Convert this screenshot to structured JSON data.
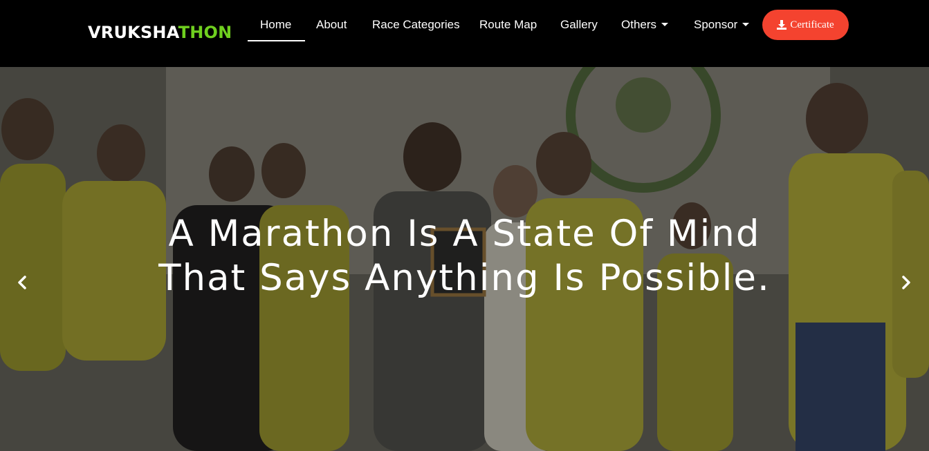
{
  "brand": {
    "part1": "VRUKSHA",
    "part2": "THON"
  },
  "nav": {
    "home": "Home",
    "about": "About",
    "race_categories": "Race Categories",
    "route_map": "Route Map",
    "gallery": "Gallery",
    "others": "Others",
    "sponsor": "Sponsor"
  },
  "certificate": {
    "label": "Certificate",
    "icon": "download-icon"
  },
  "hero": {
    "caption": "A Marathon Is A State Of Mind That Says Anything Is Possible.",
    "prev_icon": "chevron-left-icon",
    "next_icon": "chevron-right-icon"
  },
  "colors": {
    "brand_accent": "#6fcf1f",
    "certificate_button": "#f4432f",
    "navbar_bg": "#000000"
  }
}
